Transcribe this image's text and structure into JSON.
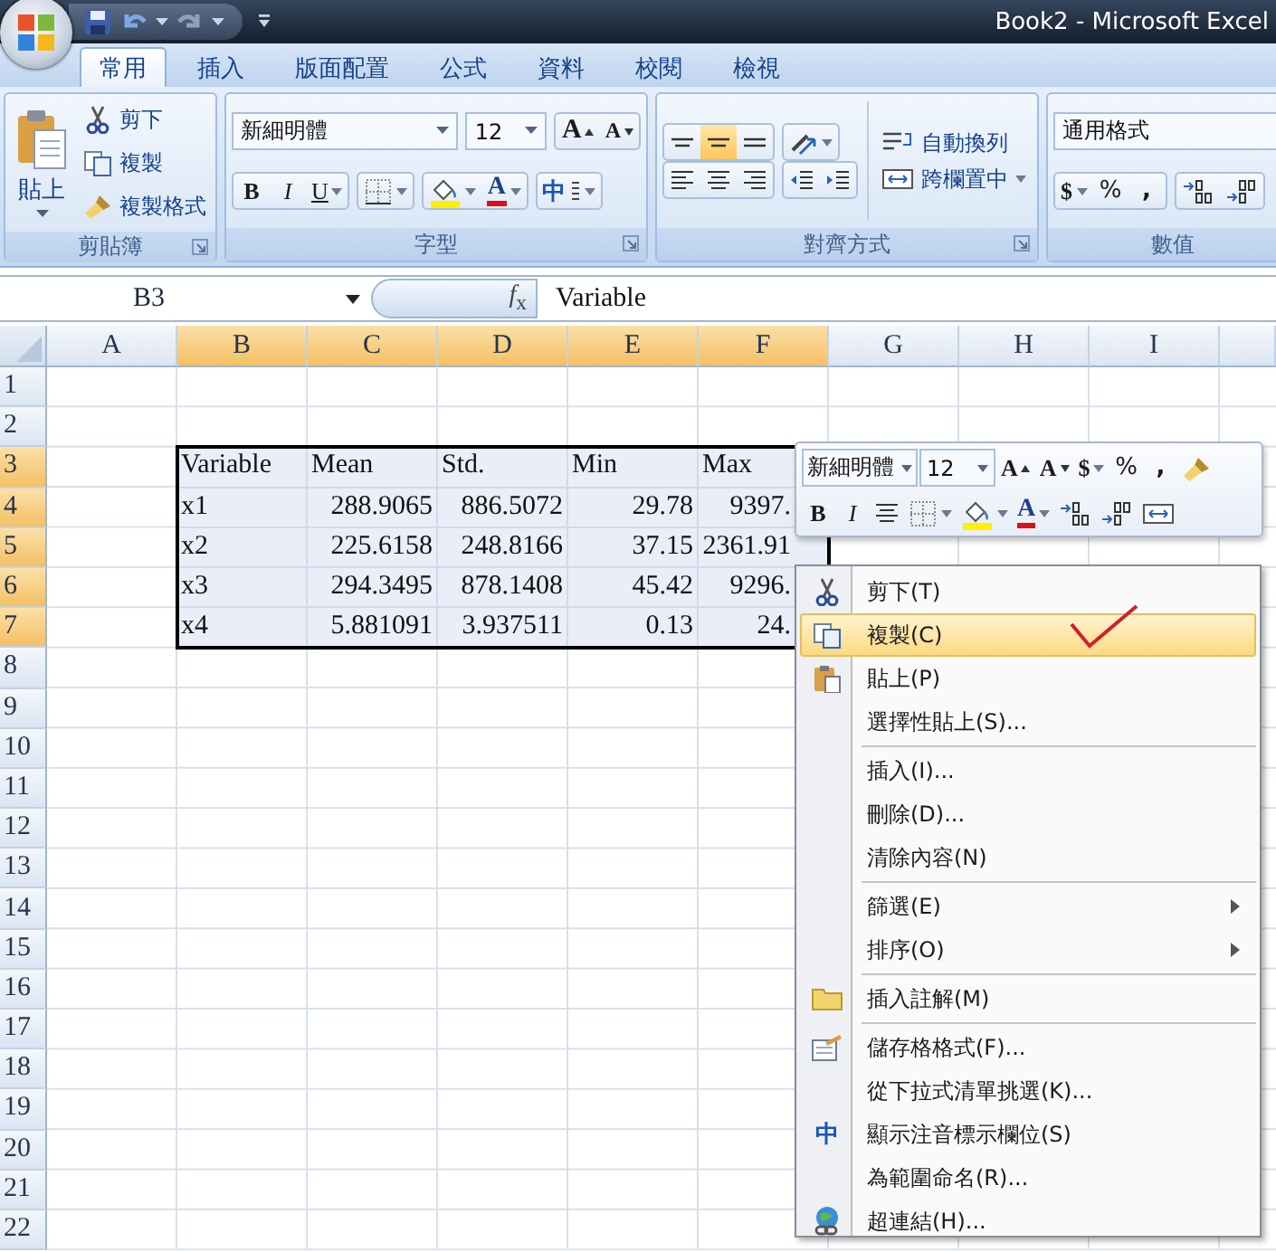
{
  "window": {
    "title": "Book2 - Microsoft Excel"
  },
  "tabs": [
    {
      "label": "常用",
      "selected": true
    },
    {
      "label": "插入",
      "selected": false
    },
    {
      "label": "版面配置",
      "selected": false
    },
    {
      "label": "公式",
      "selected": false
    },
    {
      "label": "資料",
      "selected": false
    },
    {
      "label": "校閱",
      "selected": false
    },
    {
      "label": "檢視",
      "selected": false
    }
  ],
  "ribbon": {
    "clipboard": {
      "paste": "貼上",
      "cut": "剪下",
      "copy": "複製",
      "format_painter": "複製格式",
      "label": "剪貼簿"
    },
    "font": {
      "name": "新細明體",
      "size": "12",
      "grow": "A",
      "shrink": "A",
      "bold": "B",
      "italic": "I",
      "underline": "U",
      "font_color": "A",
      "phonetic": "中",
      "label": "字型"
    },
    "alignment": {
      "wrap_text": "自動換列",
      "merge_center": "跨欄置中",
      "label": "對齊方式"
    },
    "number": {
      "format": "通用格式",
      "currency": "$",
      "percent": "%",
      "comma": ",",
      "label": "數值"
    }
  },
  "formula_bar": {
    "name_box": "B3",
    "function_label": "*f*$_{x}$",
    "value": "Variable"
  },
  "sheet": {
    "columns": [
      {
        "label": "A",
        "selected": false
      },
      {
        "label": "B",
        "selected": true
      },
      {
        "label": "C",
        "selected": true
      },
      {
        "label": "D",
        "selected": true
      },
      {
        "label": "E",
        "selected": true
      },
      {
        "label": "F",
        "selected": true
      },
      {
        "label": "G",
        "selected": false
      },
      {
        "label": "H",
        "selected": false
      },
      {
        "label": "I",
        "selected": false
      }
    ],
    "rows": [
      {
        "label": "1",
        "selected": false
      },
      {
        "label": "2",
        "selected": false
      },
      {
        "label": "3",
        "selected": true
      },
      {
        "label": "4",
        "selected": true
      },
      {
        "label": "5",
        "selected": true
      },
      {
        "label": "6",
        "selected": true
      },
      {
        "label": "7",
        "selected": true
      },
      {
        "label": "8",
        "selected": false
      },
      {
        "label": "9",
        "selected": false
      },
      {
        "label": "10",
        "selected": false
      },
      {
        "label": "11",
        "selected": false
      },
      {
        "label": "12",
        "selected": false
      },
      {
        "label": "13",
        "selected": false
      },
      {
        "label": "14",
        "selected": false
      },
      {
        "label": "15",
        "selected": false
      },
      {
        "label": "16",
        "selected": false
      },
      {
        "label": "17",
        "selected": false
      },
      {
        "label": "18",
        "selected": false
      },
      {
        "label": "19",
        "selected": false
      },
      {
        "label": "20",
        "selected": false
      },
      {
        "label": "21",
        "selected": false
      },
      {
        "label": "22",
        "selected": false
      }
    ],
    "table": {
      "header": [
        "Variable",
        "Mean",
        "Std.",
        "Min",
        "Max"
      ],
      "rows": [
        [
          "x1",
          "288.9065",
          "886.5072",
          "29.78",
          "9397."
        ],
        [
          "x2",
          "225.6158",
          "248.8166",
          "37.15",
          "2361.91"
        ],
        [
          "x3",
          "294.3495",
          "878.1408",
          "45.42",
          "9296."
        ],
        [
          "x4",
          "5.881091",
          "3.937511",
          "0.13",
          "24."
        ]
      ]
    }
  },
  "mini_toolbar": {
    "font": "新細明體",
    "size": "12",
    "grow": "A",
    "shrink": "A",
    "currency": "$",
    "percent": "%",
    "comma": ",",
    "bold": "B",
    "italic": "I",
    "font_color": "A"
  },
  "context_menu": {
    "items": [
      {
        "kind": "item",
        "label": "剪下(T)",
        "selected": false,
        "submenu": false
      },
      {
        "kind": "item",
        "label": "複製(C)",
        "selected": true,
        "submenu": false
      },
      {
        "kind": "item",
        "label": "貼上(P)",
        "selected": false,
        "submenu": false
      },
      {
        "kind": "item",
        "label": "選擇性貼上(S)...",
        "selected": false,
        "submenu": false
      },
      {
        "kind": "separator"
      },
      {
        "kind": "item",
        "label": "插入(I)...",
        "selected": false,
        "submenu": false
      },
      {
        "kind": "item",
        "label": "刪除(D)...",
        "selected": false,
        "submenu": false
      },
      {
        "kind": "item",
        "label": "清除內容(N)",
        "selected": false,
        "submenu": false
      },
      {
        "kind": "separator"
      },
      {
        "kind": "item",
        "label": "篩選(E)",
        "selected": false,
        "submenu": true
      },
      {
        "kind": "item",
        "label": "排序(O)",
        "selected": false,
        "submenu": true
      },
      {
        "kind": "separator"
      },
      {
        "kind": "item",
        "label": "插入註解(M)",
        "selected": false,
        "submenu": false
      },
      {
        "kind": "separator"
      },
      {
        "kind": "item",
        "label": "儲存格格式(F)...",
        "selected": false,
        "submenu": false
      },
      {
        "kind": "item",
        "label": "從下拉式清單挑選(K)...",
        "selected": false,
        "submenu": false
      },
      {
        "kind": "item",
        "label": "顯示注音標示欄位(S)",
        "selected": false,
        "submenu": false,
        "glyph": "中"
      },
      {
        "kind": "item",
        "label": "為範圍命名(R)...",
        "selected": false,
        "submenu": false
      },
      {
        "kind": "item",
        "label": "超連結(H)...",
        "selected": false,
        "submenu": false
      }
    ]
  }
}
